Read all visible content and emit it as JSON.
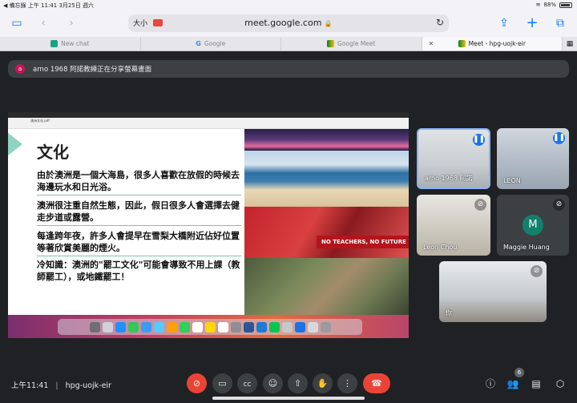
{
  "status_bar": {
    "left": "◀ 備忘錄   上午 11:41   3月25日 週六",
    "battery": "88%"
  },
  "safari": {
    "text_size_label": "大小",
    "url": "meet.google.com",
    "tabs": [
      {
        "label": "New chat",
        "icon": "chat-icon"
      },
      {
        "label": "Google",
        "icon": "google-icon"
      },
      {
        "label": "Google Meet",
        "icon": "meet-icon"
      },
      {
        "label": "Meet - hpg-uojk-eir",
        "icon": "meet-icon",
        "active": true
      }
    ]
  },
  "banner": {
    "avatar_letter": "a",
    "text": "arno 1968 阿諾教練正在分享螢幕畫面"
  },
  "slide": {
    "doc_name": "澳洲文化.pdf",
    "title": "文化",
    "paragraphs": [
      "由於澳洲是一個大海島，很多人喜歡在放假的時候去海邊玩水和日光浴。",
      "澳洲很注重自然生態，因此，假日很多人會選擇去健走步道或露營。",
      "每逢跨年夜，許多人會提早在雪梨大橋附近佔好位置等著欣賞美麗的煙火。",
      "冷知識：澳洲的\"罷工文化\"可能會導致不用上課（教師罷工），或地鐵罷工！"
    ],
    "protest_banner": "NO TEACHERS, NO FUTURE"
  },
  "participants": [
    {
      "name": "arno 1968 阿諾",
      "mic": "active"
    },
    {
      "name": "LEON",
      "mic": "active"
    },
    {
      "name": "Leon Chou",
      "mic": "muted"
    },
    {
      "name": "Maggie Huang",
      "mic": "muted",
      "avatar": "M"
    },
    {
      "name": "你",
      "mic": "muted"
    }
  ],
  "bottom": {
    "time": "上午11:41",
    "separator": "|",
    "meeting_code": "hpg-uojk-eir",
    "people_count": "6"
  },
  "colors": {
    "meet_bg": "#202124",
    "hangup_red": "#ea4335",
    "active_blue": "#1a73e8"
  }
}
